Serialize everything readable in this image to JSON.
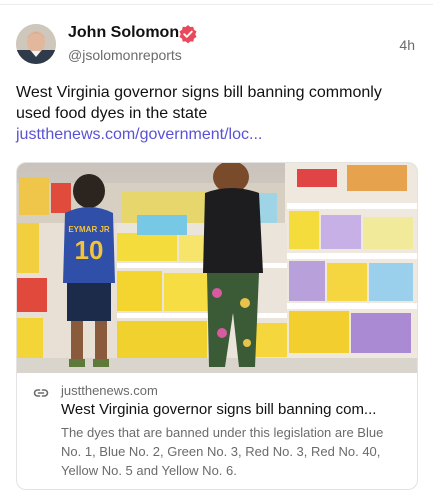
{
  "post": {
    "author": {
      "name": "John Solomon",
      "handle": "@jsolomonreports",
      "verified": true
    },
    "timestamp": "4h",
    "text": "West Virginia governor signs bill banning commonly used food dyes in the state",
    "link_text": "justthenews.com/government/loc..."
  },
  "card": {
    "domain": "justthenews.com",
    "title": "West Virginia governor signs bill banning com...",
    "description": "The dyes that are banned under this legislation are Blue No. 1, Blue No. 2, Green No. 3, Red No. 3, Red No. 40, Yellow No. 5 and Yellow No. 6.",
    "image": {
      "shirt_text": "EYMAR JR",
      "shirt_number": "10"
    }
  },
  "colors": {
    "link": "#5a52d6",
    "verified_badge": "#e8495c",
    "muted_text": "#6b6b6b"
  },
  "icons": [
    "avatar",
    "verified-badge-icon",
    "link-icon"
  ]
}
